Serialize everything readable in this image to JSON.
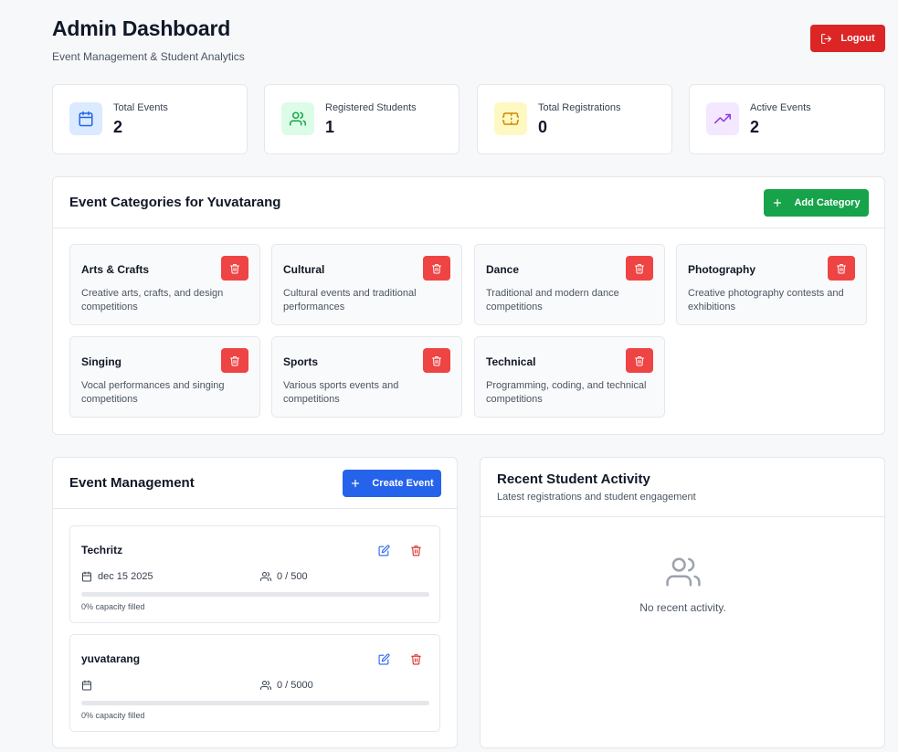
{
  "header": {
    "title": "Admin Dashboard",
    "subtitle": "Event Management & Student Analytics",
    "logout_label": "Logout"
  },
  "stats": [
    {
      "label": "Total Events",
      "value": "2",
      "icon": "calendar-icon",
      "color": "#2563eb",
      "bg": "#dbeafe"
    },
    {
      "label": "Registered Students",
      "value": "1",
      "icon": "users-icon",
      "color": "#16a34a",
      "bg": "#dcfce7"
    },
    {
      "label": "Total Registrations",
      "value": "0",
      "icon": "ticket-icon",
      "color": "#ca8a04",
      "bg": "#fef9c3"
    },
    {
      "label": "Active Events",
      "value": "2",
      "icon": "trending-up-icon",
      "color": "#9333ea",
      "bg": "#f3e8ff"
    }
  ],
  "categories_panel": {
    "title": "Event Categories for Yuvatarang",
    "add_label": "Add Category",
    "items": [
      {
        "name": "Arts & Crafts",
        "description": "Creative arts, crafts, and design competitions"
      },
      {
        "name": "Cultural",
        "description": "Cultural events and traditional performances"
      },
      {
        "name": "Dance",
        "description": "Traditional and modern dance competitions"
      },
      {
        "name": "Photography",
        "description": "Creative photography contests and exhibitions"
      },
      {
        "name": "Singing",
        "description": "Vocal performances and singing competitions"
      },
      {
        "name": "Sports",
        "description": "Various sports events and competitions"
      },
      {
        "name": "Technical",
        "description": "Programming, coding, and technical competitions"
      }
    ]
  },
  "events_panel": {
    "title": "Event Management",
    "create_label": "Create Event",
    "events": [
      {
        "name": "Techritz",
        "date": "dec 15 2025",
        "capacity": "0 / 500",
        "fill_text": "0% capacity filled",
        "fill_percent": 0
      },
      {
        "name": "yuvatarang",
        "date": "",
        "capacity": "0 / 5000",
        "fill_text": "0% capacity filled",
        "fill_percent": 0
      }
    ]
  },
  "activity_panel": {
    "title": "Recent Student Activity",
    "subtitle": "Latest registrations and student engagement",
    "empty_text": "No recent activity."
  },
  "colors": {
    "danger": "#dc2626",
    "danger_light": "#ef4444",
    "success": "#16a34a",
    "primary": "#2563eb"
  }
}
